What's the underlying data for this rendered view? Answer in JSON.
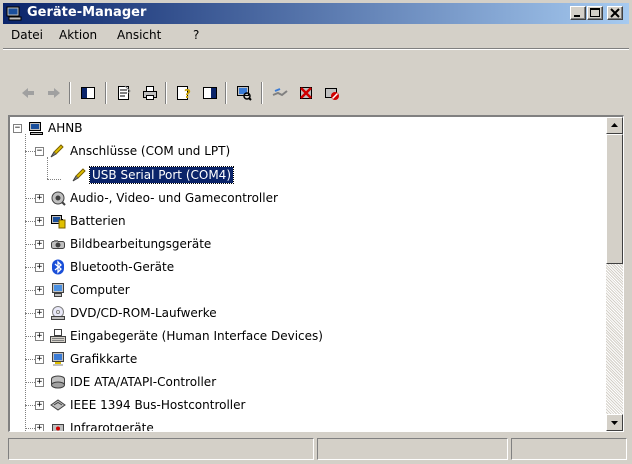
{
  "window": {
    "title": "Geräte-Manager"
  },
  "menu": {
    "datei": "Datei",
    "aktion": "Aktion",
    "ansicht": "Ansicht",
    "help": "?"
  },
  "toolbar": {
    "icons": [
      "back-arrow-icon",
      "forward-arrow-icon",
      "show-hide-console-tree-icon",
      "properties-icon",
      "print-icon",
      "help-icon",
      "show-hide-action-pane-icon",
      "scan-hardware-icon",
      "uninstall-icon",
      "disable-device-icon",
      "update-driver-icon"
    ]
  },
  "tree": {
    "root": "AHNB",
    "items": [
      {
        "label": "Anschlüsse (COM und LPT)",
        "expanded": true,
        "icon": "port-icon"
      },
      {
        "label": "USB Serial Port (COM4)",
        "child": true,
        "selected": true,
        "icon": "port-icon"
      },
      {
        "label": "Audio-, Video- und Gamecontroller",
        "icon": "audio-icon"
      },
      {
        "label": "Batterien",
        "icon": "battery-icon"
      },
      {
        "label": "Bildbearbeitungsgeräte",
        "icon": "camera-icon"
      },
      {
        "label": "Bluetooth-Geräte",
        "icon": "bluetooth-icon"
      },
      {
        "label": "Computer",
        "icon": "computer-icon"
      },
      {
        "label": "DVD/CD-ROM-Laufwerke",
        "icon": "cdrom-icon"
      },
      {
        "label": "Eingabegeräte (Human Interface Devices)",
        "icon": "hid-icon"
      },
      {
        "label": "Grafikkarte",
        "icon": "display-adapter-icon"
      },
      {
        "label": "IDE ATA/ATAPI-Controller",
        "icon": "ide-controller-icon"
      },
      {
        "label": "IEEE 1394 Bus-Hostcontroller",
        "icon": "firewire-icon"
      },
      {
        "label": "Infrarotgeräte",
        "icon": "infrared-icon"
      }
    ]
  },
  "status": {
    "pane1": "",
    "pane2": "",
    "pane3": ""
  }
}
